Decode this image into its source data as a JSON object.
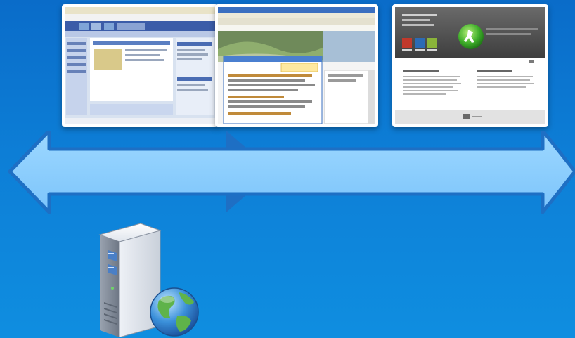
{
  "thumbnails": [
    {
      "icon": "legacy-web-portal-screenshot"
    },
    {
      "icon": "browser-window-screenshot"
    },
    {
      "icon": "modern-web-app-screenshot"
    }
  ],
  "arrow": {
    "icon": "double-headed-arrow",
    "fill": "#8fd0ff",
    "stroke": "#1e6fc4"
  },
  "server": {
    "icon": "web-server-globe-icon"
  },
  "colors": {
    "background_top": "#0a6cc9",
    "background_bottom": "#0f8ee0"
  }
}
